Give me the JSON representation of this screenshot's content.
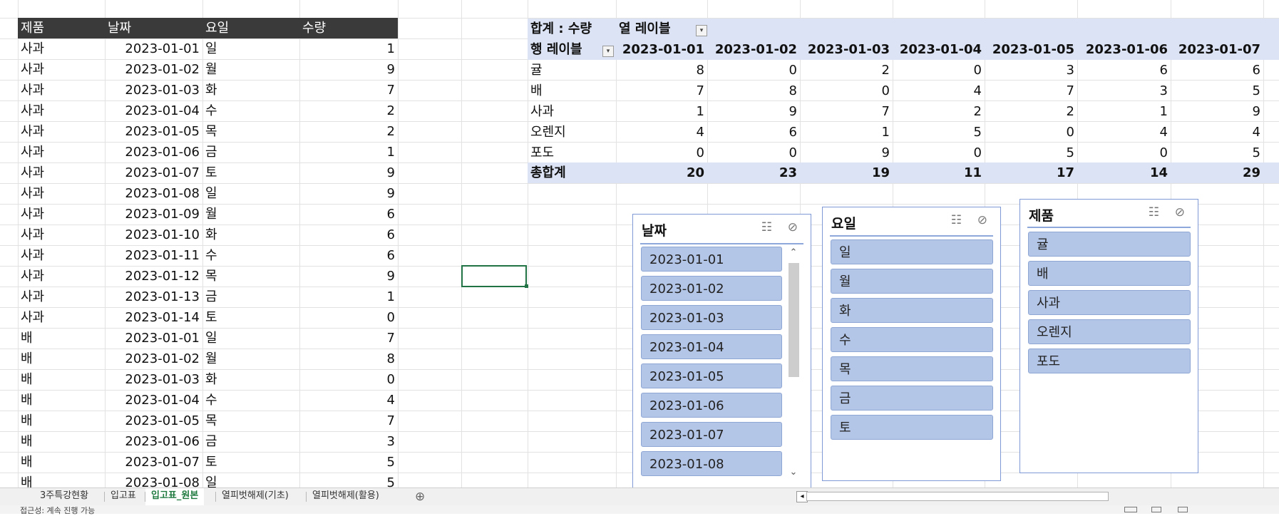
{
  "table": {
    "headers": [
      "제품",
      "날짜",
      "요일",
      "수량"
    ],
    "rows": [
      [
        "사과",
        "2023-01-01",
        "일",
        "1"
      ],
      [
        "사과",
        "2023-01-02",
        "월",
        "9"
      ],
      [
        "사과",
        "2023-01-03",
        "화",
        "7"
      ],
      [
        "사과",
        "2023-01-04",
        "수",
        "2"
      ],
      [
        "사과",
        "2023-01-05",
        "목",
        "2"
      ],
      [
        "사과",
        "2023-01-06",
        "금",
        "1"
      ],
      [
        "사과",
        "2023-01-07",
        "토",
        "9"
      ],
      [
        "사과",
        "2023-01-08",
        "일",
        "9"
      ],
      [
        "사과",
        "2023-01-09",
        "월",
        "6"
      ],
      [
        "사과",
        "2023-01-10",
        "화",
        "6"
      ],
      [
        "사과",
        "2023-01-11",
        "수",
        "6"
      ],
      [
        "사과",
        "2023-01-12",
        "목",
        "9"
      ],
      [
        "사과",
        "2023-01-13",
        "금",
        "1"
      ],
      [
        "사과",
        "2023-01-14",
        "토",
        "0"
      ],
      [
        "배",
        "2023-01-01",
        "일",
        "7"
      ],
      [
        "배",
        "2023-01-02",
        "월",
        "8"
      ],
      [
        "배",
        "2023-01-03",
        "화",
        "0"
      ],
      [
        "배",
        "2023-01-04",
        "수",
        "4"
      ],
      [
        "배",
        "2023-01-05",
        "목",
        "7"
      ],
      [
        "배",
        "2023-01-06",
        "금",
        "3"
      ],
      [
        "배",
        "2023-01-07",
        "토",
        "5"
      ],
      [
        "배",
        "2023-01-08",
        "일",
        "5"
      ]
    ]
  },
  "pivot": {
    "sum_label": "합계 : 수량",
    "col_label": "열 레이블",
    "row_label": "행 레이블",
    "dates": [
      "2023-01-01",
      "2023-01-02",
      "2023-01-03",
      "2023-01-04",
      "2023-01-05",
      "2023-01-06",
      "2023-01-07"
    ],
    "rows": [
      {
        "name": "귤",
        "values": [
          "8",
          "0",
          "2",
          "0",
          "3",
          "6",
          "6"
        ]
      },
      {
        "name": "배",
        "values": [
          "7",
          "8",
          "0",
          "4",
          "7",
          "3",
          "5"
        ]
      },
      {
        "name": "사과",
        "values": [
          "1",
          "9",
          "7",
          "2",
          "2",
          "1",
          "9"
        ]
      },
      {
        "name": "오렌지",
        "values": [
          "4",
          "6",
          "1",
          "5",
          "0",
          "4",
          "4"
        ]
      },
      {
        "name": "포도",
        "values": [
          "0",
          "0",
          "9",
          "0",
          "5",
          "0",
          "5"
        ]
      }
    ],
    "total": {
      "name": "총합계",
      "values": [
        "20",
        "23",
        "19",
        "11",
        "17",
        "14",
        "29"
      ]
    }
  },
  "slicers": {
    "date": {
      "title": "날짜",
      "items": [
        "2023-01-01",
        "2023-01-02",
        "2023-01-03",
        "2023-01-04",
        "2023-01-05",
        "2023-01-06",
        "2023-01-07",
        "2023-01-08"
      ]
    },
    "weekday": {
      "title": "요일",
      "items": [
        "일",
        "월",
        "화",
        "수",
        "목",
        "금",
        "토"
      ]
    },
    "product": {
      "title": "제품",
      "items": [
        "귤",
        "배",
        "사과",
        "오렌지",
        "포도"
      ]
    }
  },
  "icons": {
    "multi_select": "☷",
    "clear_filter": "⊘",
    "scroll_up": "⌃",
    "scroll_down": "⌄",
    "add_sheet": "⊕",
    "scroll_left": "◂"
  },
  "sheets": {
    "tabs": [
      "3주특강현황",
      "입고표",
      "입고표_원본",
      "열피벗해제(기초)",
      "열피벗해제(활용)"
    ],
    "active": "입고표_원본"
  },
  "status": {
    "text": "접근성: 계속 진행 가능"
  },
  "colors": {
    "accent": "#1f7a3f",
    "slicer_item": "#b4c6e7",
    "header_fill": "#3a3a3a",
    "pivot_band": "#dce3f4"
  }
}
